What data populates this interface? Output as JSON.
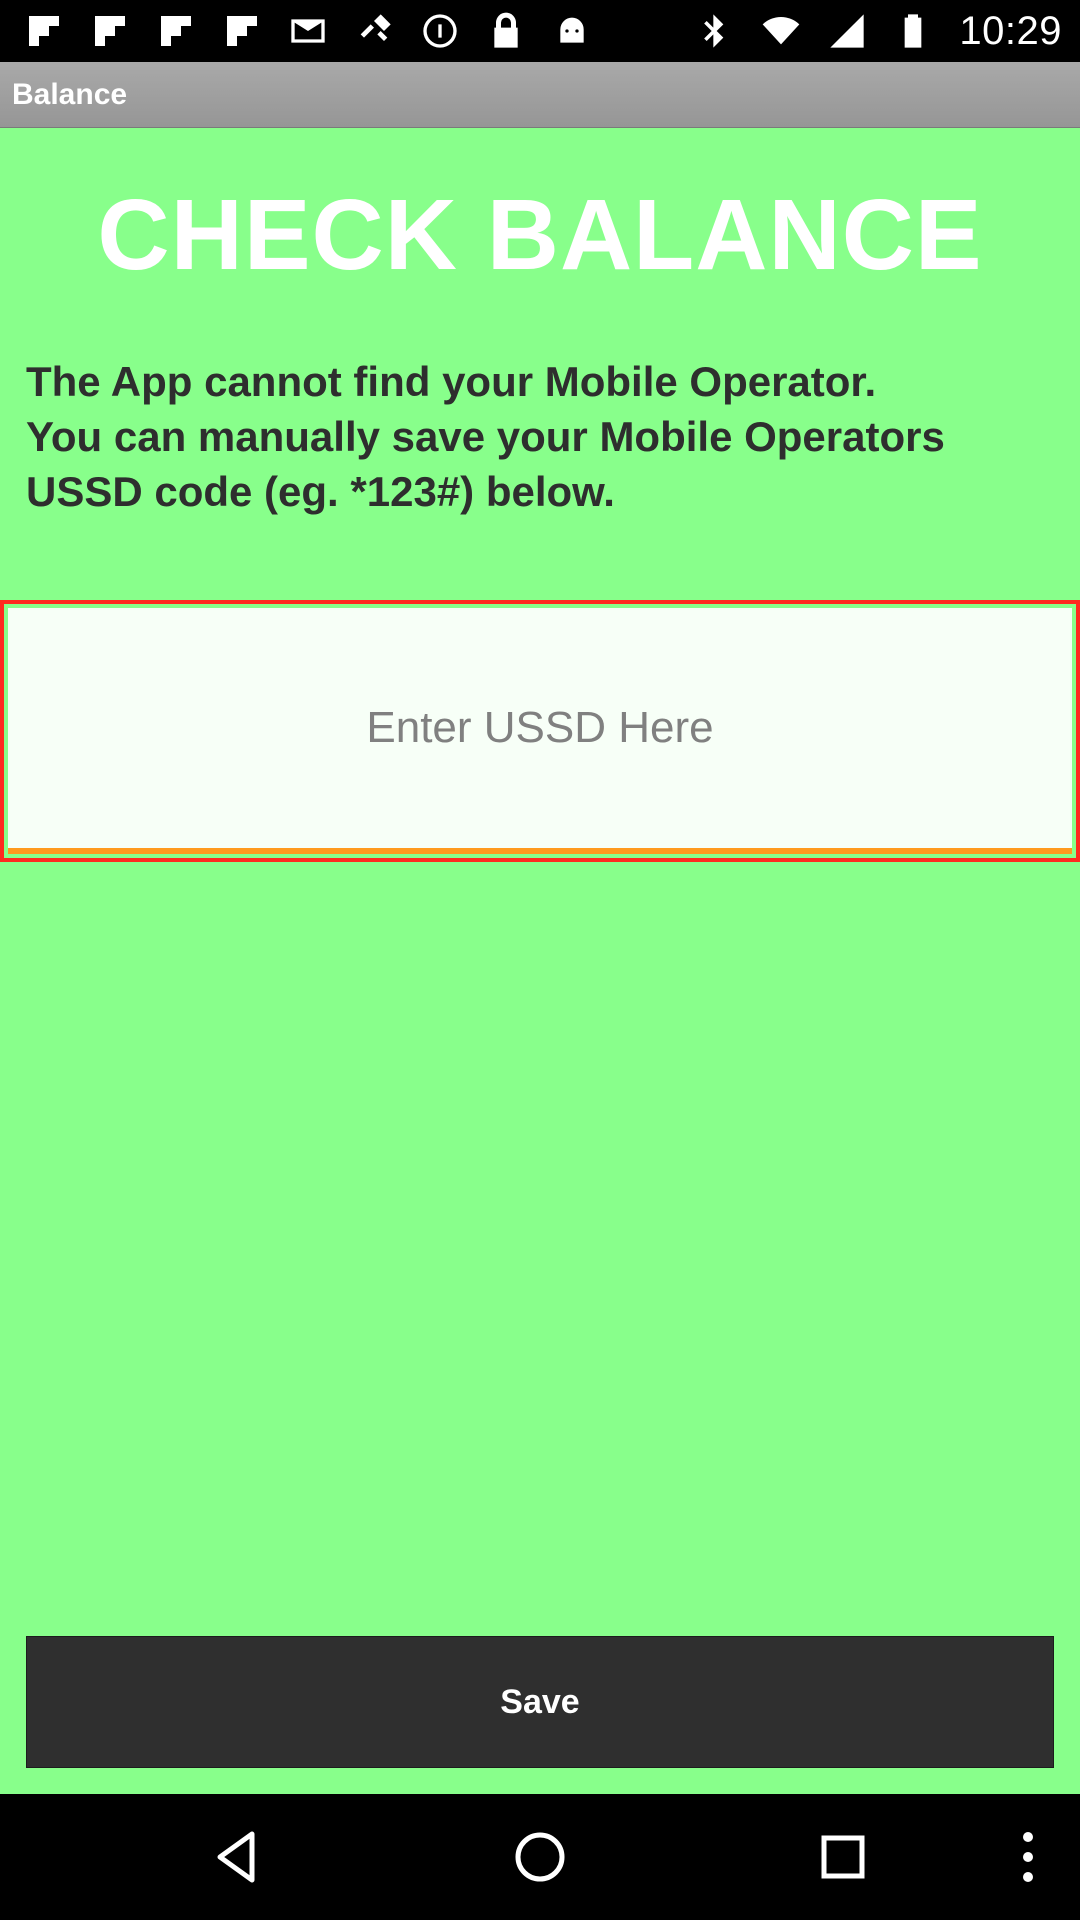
{
  "status_bar": {
    "time": "10:29",
    "left_icons": [
      "flipboard-icon",
      "flipboard-icon",
      "flipboard-icon",
      "flipboard-icon",
      "mail-icon",
      "fake-gps-icon",
      "info-icon",
      "lock-icon",
      "android-icon"
    ],
    "right_icons": [
      "bluetooth-icon",
      "wifi-icon",
      "signal-icon",
      "battery-icon"
    ]
  },
  "title_bar": {
    "title": "Balance"
  },
  "main": {
    "heading": "CHECK BALANCE",
    "message_lines": [
      "The App cannot find your Mobile Operator.",
      "You can manually save your Mobile Operators",
      "USSD code (eg. *123#) below."
    ],
    "ussd_input": {
      "placeholder": "Enter USSD Here",
      "value": ""
    },
    "save_label": "Save"
  },
  "nav_bar": {
    "buttons": [
      "back-icon",
      "home-icon",
      "recents-icon",
      "overflow-menu-icon"
    ]
  },
  "colors": {
    "background": "#88ff8b",
    "heading": "#ffffff",
    "input_border": "#ff2a1f",
    "input_underline": "#ff9a1e",
    "button": "#2f2f2f"
  }
}
